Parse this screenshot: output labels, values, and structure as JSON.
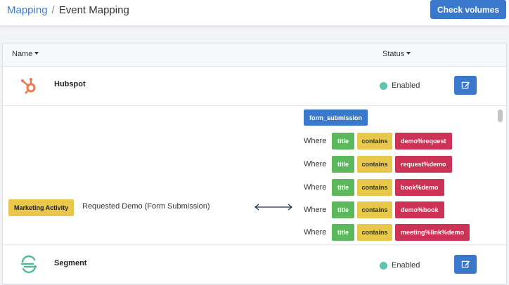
{
  "breadcrumb": {
    "parent": "Mapping",
    "separator": "/",
    "current": "Event Mapping"
  },
  "toolbar": {
    "check_volumes_label": "Check volumes"
  },
  "table": {
    "columns": {
      "name": "Name",
      "status": "Status"
    }
  },
  "integrations": [
    {
      "name": "Hubspot",
      "icon": "hubspot-icon",
      "status": "Enabled"
    },
    {
      "name": "Segment",
      "icon": "segment-icon",
      "status": "Enabled"
    }
  ],
  "mapping": {
    "activity": "Marketing Activity",
    "event_name": "Requested Demo (Form Submission)",
    "source_event": "form_submission",
    "conditions": [
      {
        "where": "Where",
        "field": "title",
        "operator": "contains",
        "value": "demo%request"
      },
      {
        "where": "Where",
        "field": "title",
        "operator": "contains",
        "value": "request%demo"
      },
      {
        "where": "Where",
        "field": "title",
        "operator": "contains",
        "value": "book%demo"
      },
      {
        "where": "Where",
        "field": "title",
        "operator": "contains",
        "value": "demo%book"
      },
      {
        "where": "Where",
        "field": "title",
        "operator": "contains",
        "value": "meeting%link%demo"
      }
    ]
  },
  "colors": {
    "primary": "#3a78cc",
    "enabled": "#5fc1b0",
    "field": "#5cb85c",
    "operator": "#e8c84a",
    "value": "#cc3355",
    "hubspot": "#f0764d",
    "segment": "#52bd94"
  }
}
